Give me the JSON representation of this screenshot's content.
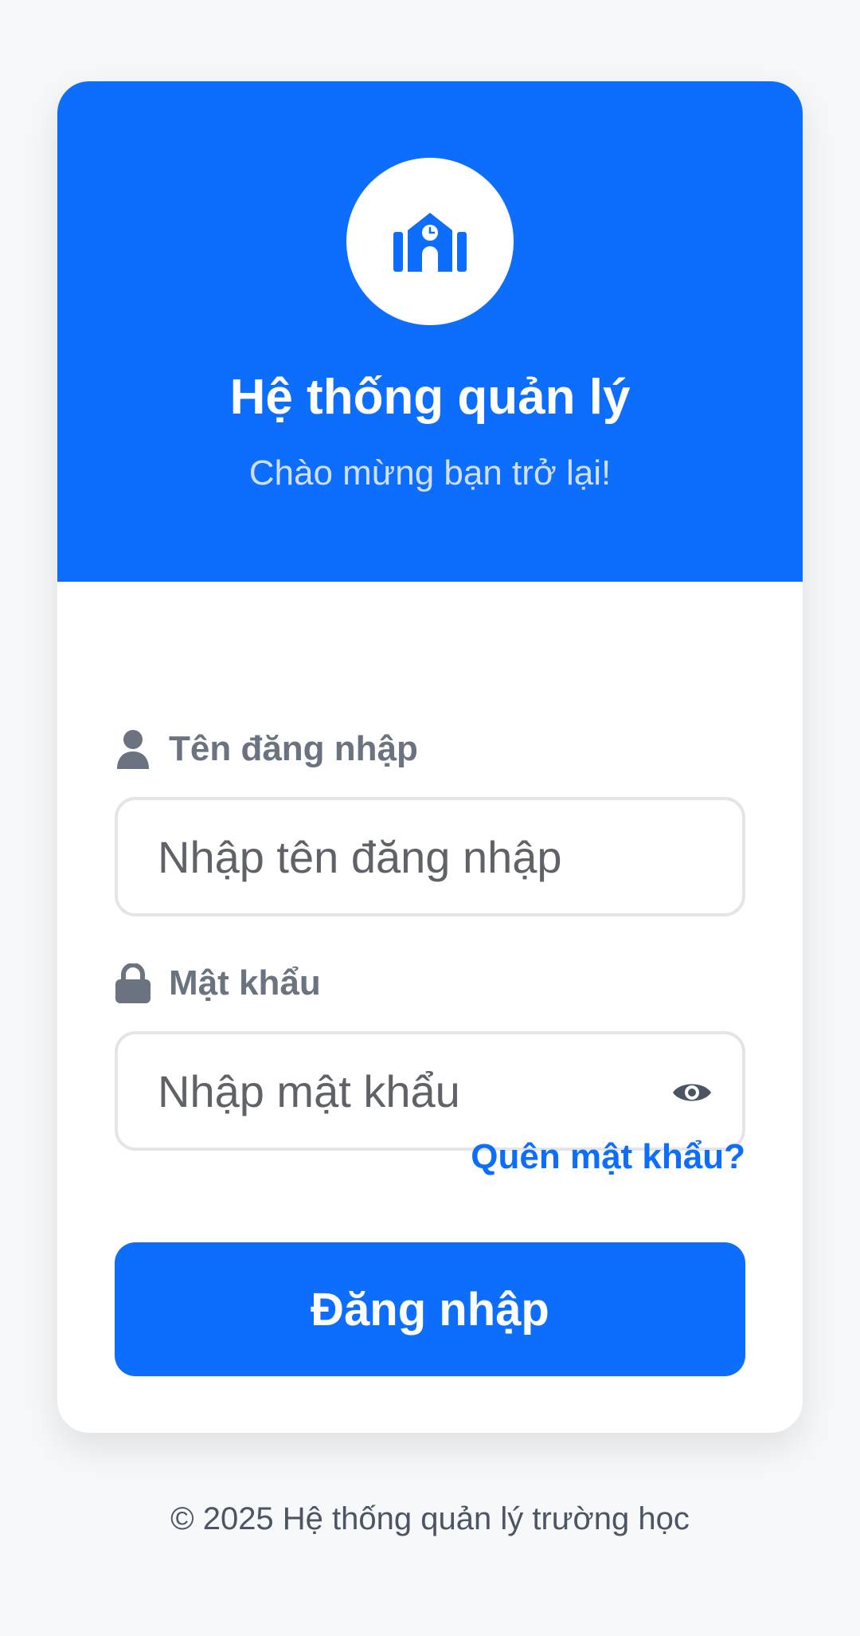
{
  "header": {
    "logo_icon": "school-icon",
    "title": "Hệ thống quản lý",
    "subtitle": "Chào mừng bạn trở lại!"
  },
  "form": {
    "username": {
      "icon": "user-icon",
      "label": "Tên đăng nhập",
      "value": "",
      "placeholder": "Nhập tên đăng nhập"
    },
    "password": {
      "icon": "lock-icon",
      "label": "Mật khẩu",
      "value": "",
      "placeholder": "Nhập mật khẩu",
      "toggle_icon": "eye-icon"
    },
    "forgot_link": "Quên mật khẩu?",
    "submit_label": "Đăng nhập"
  },
  "footer": {
    "text": "© 2025 Hệ thống quản lý trường học"
  },
  "colors": {
    "primary": "#0d6efd",
    "background": "#f7f8fa",
    "card": "#ffffff",
    "label": "#6b7280"
  }
}
